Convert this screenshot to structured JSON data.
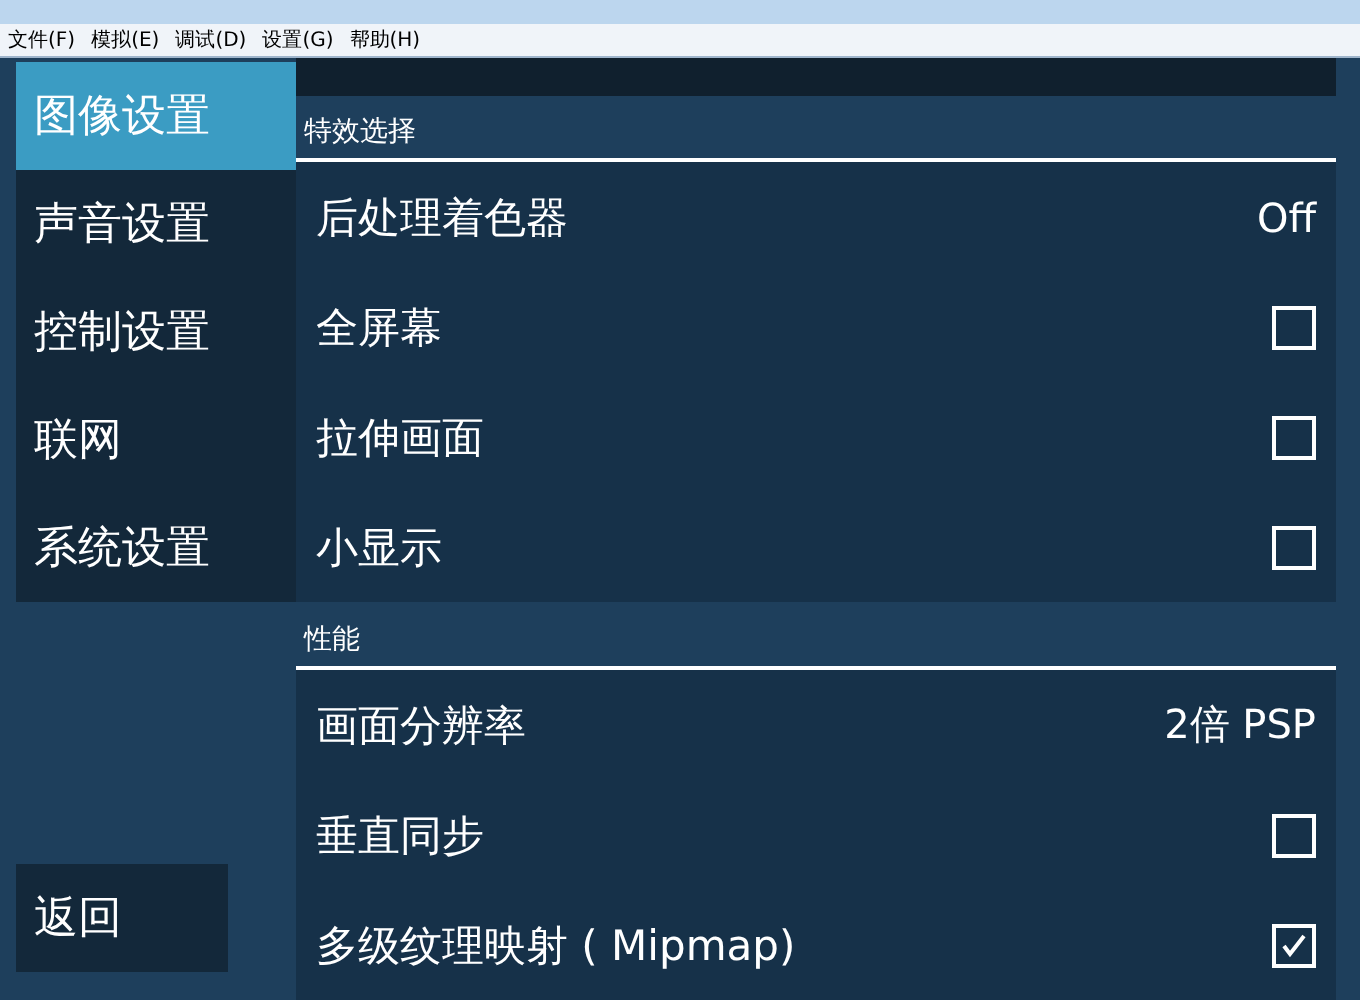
{
  "menu": [
    "文件(F)",
    "模拟(E)",
    "调试(D)",
    "设置(G)",
    "帮助(H)"
  ],
  "sidebar": {
    "items": [
      {
        "label": "图像设置",
        "selected": true
      },
      {
        "label": "声音设置",
        "selected": false
      },
      {
        "label": "控制设置",
        "selected": false
      },
      {
        "label": "联网",
        "selected": false
      },
      {
        "label": "系统设置",
        "selected": false
      }
    ],
    "back": "返回"
  },
  "sections": [
    {
      "title": "特效选择",
      "rows": [
        {
          "label": "后处理着色器",
          "kind": "value",
          "value": "Off"
        },
        {
          "label": "全屏幕",
          "kind": "checkbox",
          "checked": false
        },
        {
          "label": "拉伸画面",
          "kind": "checkbox",
          "checked": false
        },
        {
          "label": "小显示",
          "kind": "checkbox",
          "checked": false
        }
      ]
    },
    {
      "title": "性能",
      "rows": [
        {
          "label": "画面分辨率",
          "kind": "value",
          "value": "2倍 PSP"
        },
        {
          "label": "垂直同步",
          "kind": "checkbox",
          "checked": false
        },
        {
          "label": "多级纹理映射 ( Mipmap)",
          "kind": "checkbox",
          "checked": true
        }
      ]
    }
  ]
}
